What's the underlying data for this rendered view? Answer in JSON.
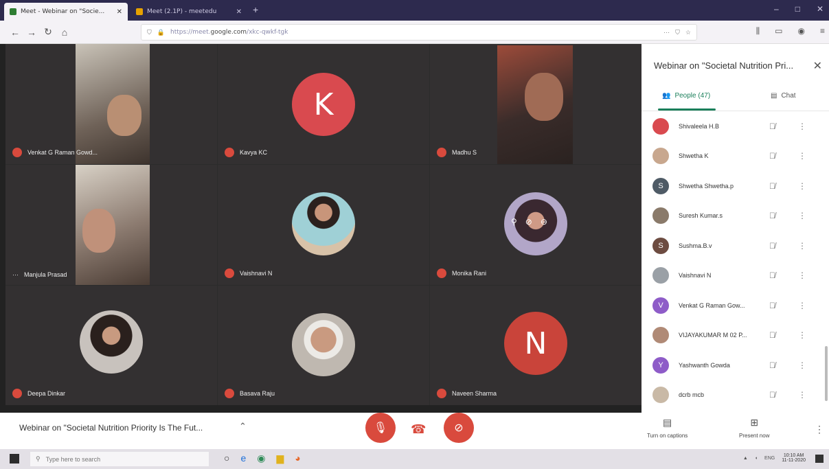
{
  "browser": {
    "tabs": [
      {
        "title": "Meet - Webinar on \"Socie..."
      },
      {
        "title": "Meet (2.1P) - meetedu"
      }
    ],
    "new_tab": "+",
    "url_prefix": "https://meet.",
    "url_domain": "google.com",
    "url_path": "/xkc-qwkf-tgk",
    "window_controls": [
      "–",
      "□",
      "✕"
    ]
  },
  "tiles": [
    {
      "name": "Venkat G Raman Gowd..."
    },
    {
      "name": "Kavya KC",
      "avatar_letter": "K",
      "avatar_color": "#d94a4f"
    },
    {
      "name": "Madhu S"
    },
    {
      "name": "Manjula Prasad"
    },
    {
      "name": "Vaishnavi N"
    },
    {
      "name": "Monika Rani"
    },
    {
      "name": "Deepa Dinkar"
    },
    {
      "name": "Basava Raju"
    },
    {
      "name": "Naveen Sharma",
      "avatar_letter": "N",
      "avatar_color": "#c9443a"
    }
  ],
  "side_panel": {
    "title": "Webinar on \"Societal Nutrition Pri...",
    "people_tab": "People (47)",
    "chat_tab": "Chat",
    "people": [
      {
        "name": "Shivaleela H.B",
        "letter": "",
        "color": "#d94a4f"
      },
      {
        "name": "Shwetha K",
        "letter": "",
        "color": "#c8a78e"
      },
      {
        "name": "Shwetha Shwetha.p",
        "letter": "S",
        "color": "#4f5b66"
      },
      {
        "name": "Suresh Kumar.s",
        "letter": "",
        "color": "#8a7a6a"
      },
      {
        "name": "Sushma.B.v",
        "letter": "S",
        "color": "#6d4c41"
      },
      {
        "name": "Vaishnavi N",
        "letter": "",
        "color": "#9aa0a6"
      },
      {
        "name": "Venkat G Raman Gow...",
        "letter": "V",
        "color": "#8e5cc8"
      },
      {
        "name": "VIJAYAKUMAR M 02 P...",
        "letter": "",
        "color": "#b08a76"
      },
      {
        "name": "Yashwanth Gowda",
        "letter": "Y",
        "color": "#8e5cc8"
      },
      {
        "name": "dcrb mcb",
        "letter": "",
        "color": "#c9b9a6"
      }
    ]
  },
  "bottom": {
    "meeting_title": "Webinar on \"Societal Nutrition Priority Is The Fut...",
    "captions_label": "Turn on captions",
    "present_label": "Present now"
  },
  "taskbar": {
    "search_placeholder": "Type here to search",
    "lang": "ENG",
    "time": "10:10 AM",
    "date": "11-11-2020"
  }
}
